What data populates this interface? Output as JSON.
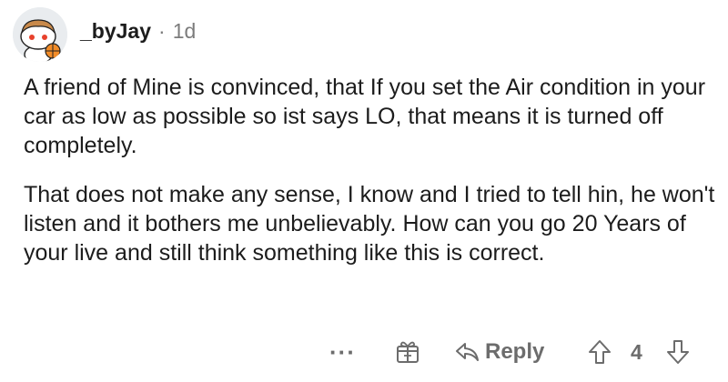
{
  "comment": {
    "username": "_byJay",
    "separator": "·",
    "age": "1d",
    "paragraphs": [
      "A friend of Mine is convinced, that If you set the Air condition in your car as low as possible so ist says LO, that means it is turned off completely.",
      "That does not make any sense, I know and I tried to tell hin, he won't listen and it bothers me unbelievably. How can you go 20 Years of your live and still think something like this is correct."
    ]
  },
  "actions": {
    "more_label": "···",
    "award_icon": "award-icon",
    "reply_icon": "reply-arrow-icon",
    "reply_label": "Reply",
    "upvote_icon": "upvote-arrow-icon",
    "score": "4",
    "downvote_icon": "downvote-arrow-icon"
  },
  "colors": {
    "text": "#1c1c1c",
    "muted": "#7c7c7c",
    "action_gray": "#6c6c6c",
    "avatar_background": "#e9ecef"
  }
}
